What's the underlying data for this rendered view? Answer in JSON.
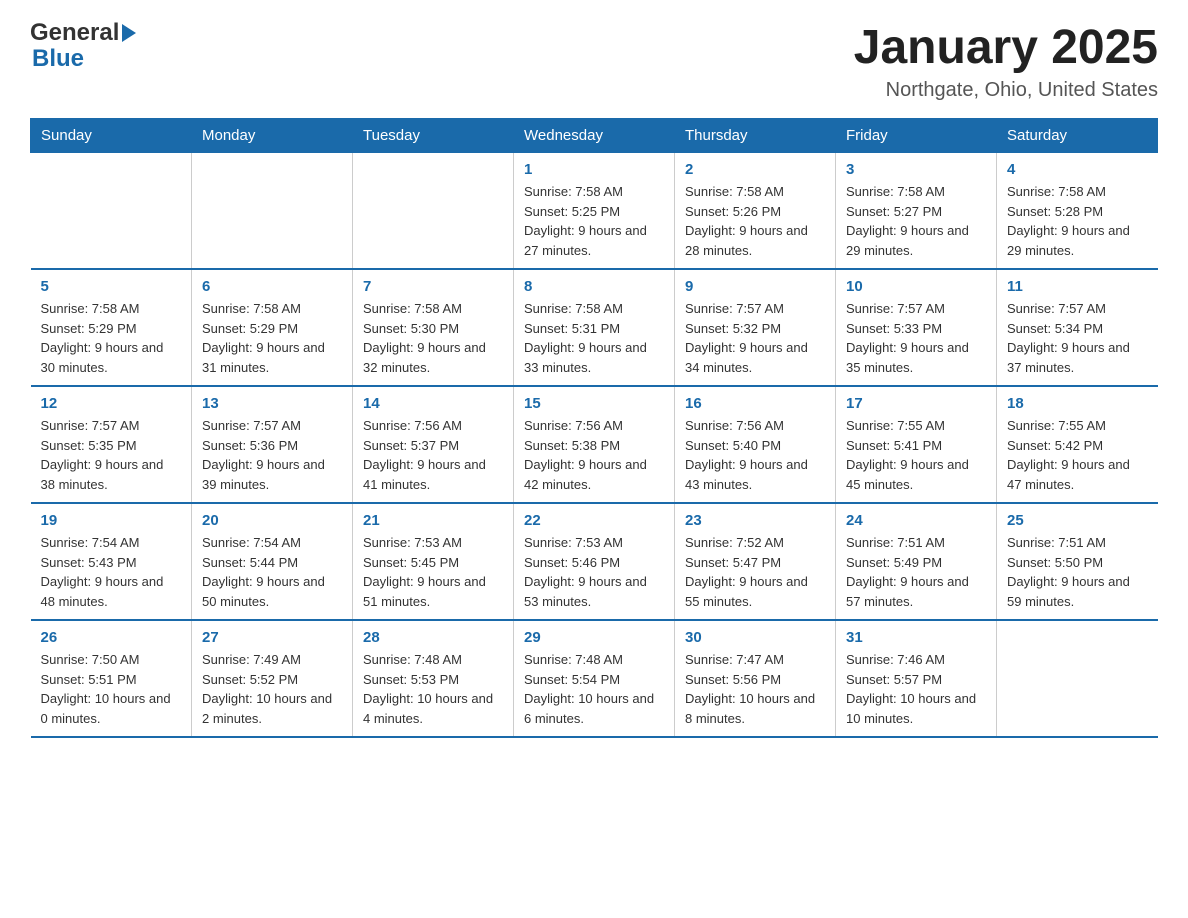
{
  "header": {
    "logo_general": "General",
    "logo_blue": "Blue",
    "title": "January 2025",
    "subtitle": "Northgate, Ohio, United States"
  },
  "days_of_week": [
    "Sunday",
    "Monday",
    "Tuesday",
    "Wednesday",
    "Thursday",
    "Friday",
    "Saturday"
  ],
  "weeks": [
    [
      {
        "day": "",
        "info": ""
      },
      {
        "day": "",
        "info": ""
      },
      {
        "day": "",
        "info": ""
      },
      {
        "day": "1",
        "info": "Sunrise: 7:58 AM\nSunset: 5:25 PM\nDaylight: 9 hours and 27 minutes."
      },
      {
        "day": "2",
        "info": "Sunrise: 7:58 AM\nSunset: 5:26 PM\nDaylight: 9 hours and 28 minutes."
      },
      {
        "day": "3",
        "info": "Sunrise: 7:58 AM\nSunset: 5:27 PM\nDaylight: 9 hours and 29 minutes."
      },
      {
        "day": "4",
        "info": "Sunrise: 7:58 AM\nSunset: 5:28 PM\nDaylight: 9 hours and 29 minutes."
      }
    ],
    [
      {
        "day": "5",
        "info": "Sunrise: 7:58 AM\nSunset: 5:29 PM\nDaylight: 9 hours and 30 minutes."
      },
      {
        "day": "6",
        "info": "Sunrise: 7:58 AM\nSunset: 5:29 PM\nDaylight: 9 hours and 31 minutes."
      },
      {
        "day": "7",
        "info": "Sunrise: 7:58 AM\nSunset: 5:30 PM\nDaylight: 9 hours and 32 minutes."
      },
      {
        "day": "8",
        "info": "Sunrise: 7:58 AM\nSunset: 5:31 PM\nDaylight: 9 hours and 33 minutes."
      },
      {
        "day": "9",
        "info": "Sunrise: 7:57 AM\nSunset: 5:32 PM\nDaylight: 9 hours and 34 minutes."
      },
      {
        "day": "10",
        "info": "Sunrise: 7:57 AM\nSunset: 5:33 PM\nDaylight: 9 hours and 35 minutes."
      },
      {
        "day": "11",
        "info": "Sunrise: 7:57 AM\nSunset: 5:34 PM\nDaylight: 9 hours and 37 minutes."
      }
    ],
    [
      {
        "day": "12",
        "info": "Sunrise: 7:57 AM\nSunset: 5:35 PM\nDaylight: 9 hours and 38 minutes."
      },
      {
        "day": "13",
        "info": "Sunrise: 7:57 AM\nSunset: 5:36 PM\nDaylight: 9 hours and 39 minutes."
      },
      {
        "day": "14",
        "info": "Sunrise: 7:56 AM\nSunset: 5:37 PM\nDaylight: 9 hours and 41 minutes."
      },
      {
        "day": "15",
        "info": "Sunrise: 7:56 AM\nSunset: 5:38 PM\nDaylight: 9 hours and 42 minutes."
      },
      {
        "day": "16",
        "info": "Sunrise: 7:56 AM\nSunset: 5:40 PM\nDaylight: 9 hours and 43 minutes."
      },
      {
        "day": "17",
        "info": "Sunrise: 7:55 AM\nSunset: 5:41 PM\nDaylight: 9 hours and 45 minutes."
      },
      {
        "day": "18",
        "info": "Sunrise: 7:55 AM\nSunset: 5:42 PM\nDaylight: 9 hours and 47 minutes."
      }
    ],
    [
      {
        "day": "19",
        "info": "Sunrise: 7:54 AM\nSunset: 5:43 PM\nDaylight: 9 hours and 48 minutes."
      },
      {
        "day": "20",
        "info": "Sunrise: 7:54 AM\nSunset: 5:44 PM\nDaylight: 9 hours and 50 minutes."
      },
      {
        "day": "21",
        "info": "Sunrise: 7:53 AM\nSunset: 5:45 PM\nDaylight: 9 hours and 51 minutes."
      },
      {
        "day": "22",
        "info": "Sunrise: 7:53 AM\nSunset: 5:46 PM\nDaylight: 9 hours and 53 minutes."
      },
      {
        "day": "23",
        "info": "Sunrise: 7:52 AM\nSunset: 5:47 PM\nDaylight: 9 hours and 55 minutes."
      },
      {
        "day": "24",
        "info": "Sunrise: 7:51 AM\nSunset: 5:49 PM\nDaylight: 9 hours and 57 minutes."
      },
      {
        "day": "25",
        "info": "Sunrise: 7:51 AM\nSunset: 5:50 PM\nDaylight: 9 hours and 59 minutes."
      }
    ],
    [
      {
        "day": "26",
        "info": "Sunrise: 7:50 AM\nSunset: 5:51 PM\nDaylight: 10 hours and 0 minutes."
      },
      {
        "day": "27",
        "info": "Sunrise: 7:49 AM\nSunset: 5:52 PM\nDaylight: 10 hours and 2 minutes."
      },
      {
        "day": "28",
        "info": "Sunrise: 7:48 AM\nSunset: 5:53 PM\nDaylight: 10 hours and 4 minutes."
      },
      {
        "day": "29",
        "info": "Sunrise: 7:48 AM\nSunset: 5:54 PM\nDaylight: 10 hours and 6 minutes."
      },
      {
        "day": "30",
        "info": "Sunrise: 7:47 AM\nSunset: 5:56 PM\nDaylight: 10 hours and 8 minutes."
      },
      {
        "day": "31",
        "info": "Sunrise: 7:46 AM\nSunset: 5:57 PM\nDaylight: 10 hours and 10 minutes."
      },
      {
        "day": "",
        "info": ""
      }
    ]
  ]
}
